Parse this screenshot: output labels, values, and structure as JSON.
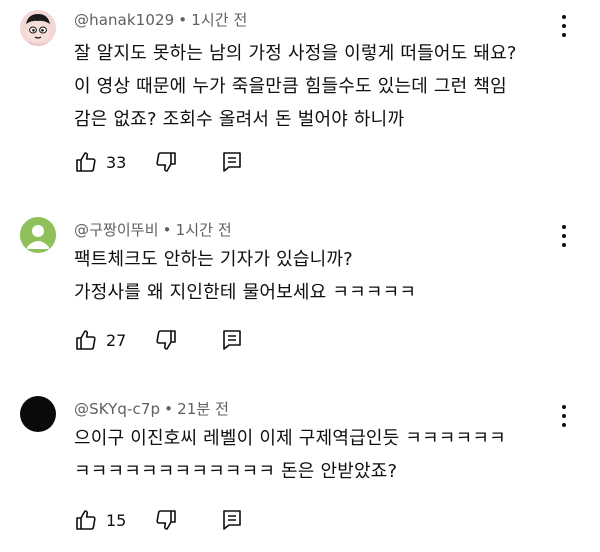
{
  "comments": [
    {
      "author": "@hanak1029",
      "time": "1시간 전",
      "lines": [
        "잘 알지도 못하는 남의 가정 사정을 이렇게 떠들어도 돼요?",
        "이 영상 때문에 누가 죽을만큼 힘들수도 있는데 그런 책임",
        "감은 없죠? 조회수 올려서 돈 벌어야 하니까"
      ],
      "likes": "33"
    },
    {
      "author": "@구짱이뚜비",
      "time": "1시간 전",
      "lines": [
        "팩트체크도 안하는 기자가 있습니까?",
        "가정사를 왜 지인한테 물어보세요 ㅋㅋㅋㅋㅋ"
      ],
      "likes": "27"
    },
    {
      "author": "@SKYq-c7p",
      "time": "21분 전",
      "lines": [
        "으이구 이진호씨 레벨이 이제 구제역급인듯 ㅋㅋㅋㅋㅋㅋ",
        "ㅋㅋㅋㅋㅋㅋㅋㅋㅋㅋㅋㅋ 돈은 안받았죠?"
      ],
      "likes": "15"
    }
  ],
  "colors": {
    "meta_text": "#606060",
    "avatar_generic": "#8fc05a",
    "avatar_dark": "#0a0a0a"
  },
  "icons": {
    "like": "thumbs-up-icon",
    "dislike": "thumbs-down-icon",
    "reply": "reply-icon",
    "more": "more-vert-icon"
  }
}
